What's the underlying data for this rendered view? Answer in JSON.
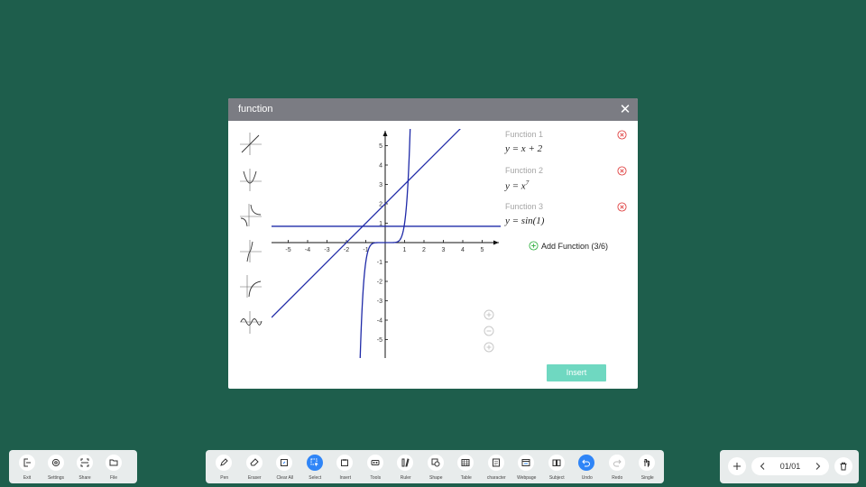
{
  "dialog": {
    "title": "function",
    "close_icon": "close-icon",
    "functions": [
      {
        "label": "Function 1",
        "expression": "y = x + 2"
      },
      {
        "label": "Function 2",
        "expression": "y = x^7"
      },
      {
        "label": "Function 3",
        "expression": "y = sin(1)"
      }
    ],
    "add_function_label": "Add Function (3/6)",
    "insert_label": "Insert",
    "templates": [
      "linear-template-icon",
      "parabola-template-icon",
      "inverse-template-icon",
      "cubic-template-icon",
      "log-template-icon",
      "sine-template-icon"
    ],
    "zoom_controls": [
      "zoom-in-icon",
      "zoom-out-icon",
      "zoom-reset-icon"
    ],
    "accent_color": "#6fd8c1",
    "delete_color": "#e04545"
  },
  "chart_data": {
    "type": "line",
    "xlim": [
      -6,
      6
    ],
    "ylim": [
      -6,
      6
    ],
    "x_ticks": [
      "-5",
      "-4",
      "-3",
      "-2",
      "-1",
      "1",
      "2",
      "3",
      "4",
      "5"
    ],
    "y_ticks": [
      "5",
      "4",
      "3",
      "2",
      "1",
      "-1",
      "-2",
      "-3",
      "-4",
      "-5"
    ],
    "grid": false,
    "series": [
      {
        "expression": "x + 2",
        "color": "#1f2aa8"
      },
      {
        "expression": "x^7",
        "color": "#1f2aa8"
      },
      {
        "expression": "sin(1)",
        "value": 0.841,
        "color": "#1f2aa8"
      }
    ]
  },
  "toolbar_left": [
    {
      "label": "Exit",
      "icon": "exit-icon"
    },
    {
      "label": "Settings",
      "icon": "gear-icon"
    },
    {
      "label": "Share",
      "icon": "share-icon"
    },
    {
      "label": "File",
      "icon": "folder-icon"
    }
  ],
  "toolbar_main": [
    {
      "label": "Pen",
      "icon": "pen-icon"
    },
    {
      "label": "Eraser",
      "icon": "eraser-icon"
    },
    {
      "label": "Clear All",
      "icon": "clear-all-icon"
    },
    {
      "label": "Select",
      "icon": "select-icon",
      "active": true
    },
    {
      "label": "Insert",
      "icon": "insert-icon"
    },
    {
      "label": "Tools",
      "icon": "tools-icon"
    },
    {
      "label": "Ruler",
      "icon": "ruler-icon"
    },
    {
      "label": "Shape",
      "icon": "shape-icon"
    },
    {
      "label": "Table",
      "icon": "table-icon"
    },
    {
      "label": "character",
      "icon": "character-icon"
    },
    {
      "label": "Webpage",
      "icon": "webpage-icon"
    },
    {
      "label": "Subject",
      "icon": "subject-icon"
    },
    {
      "label": "Undo",
      "icon": "undo-icon",
      "active": true
    },
    {
      "label": "Redo",
      "icon": "redo-icon"
    },
    {
      "label": "Single",
      "icon": "hand-icon"
    }
  ],
  "pager": {
    "page": "01/01",
    "add_icon": "add-page-icon",
    "prev_icon": "chevron-left-icon",
    "next_icon": "chevron-right-icon",
    "delete_icon": "trash-icon"
  }
}
